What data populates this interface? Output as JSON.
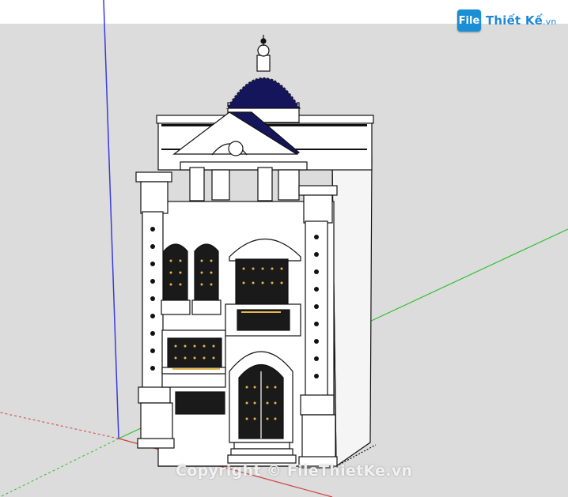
{
  "watermark": {
    "text": "Copyright © FileThietKe.vn"
  },
  "logo": {
    "icon_text": "File",
    "brand": "Thiết Kế",
    "suffix": ".vn"
  },
  "colors": {
    "sky": "#ffffff",
    "ground": "#dcdcdc",
    "axis_blue": "#3a3ae0",
    "axis_green": "#2ec02e",
    "axis_red": "#d04040",
    "dome": "#15155c",
    "building": "#ffffff",
    "outline": "#111111",
    "window_glow": "#e8b64a"
  },
  "icons": {
    "logo": "file-logo-icon"
  }
}
